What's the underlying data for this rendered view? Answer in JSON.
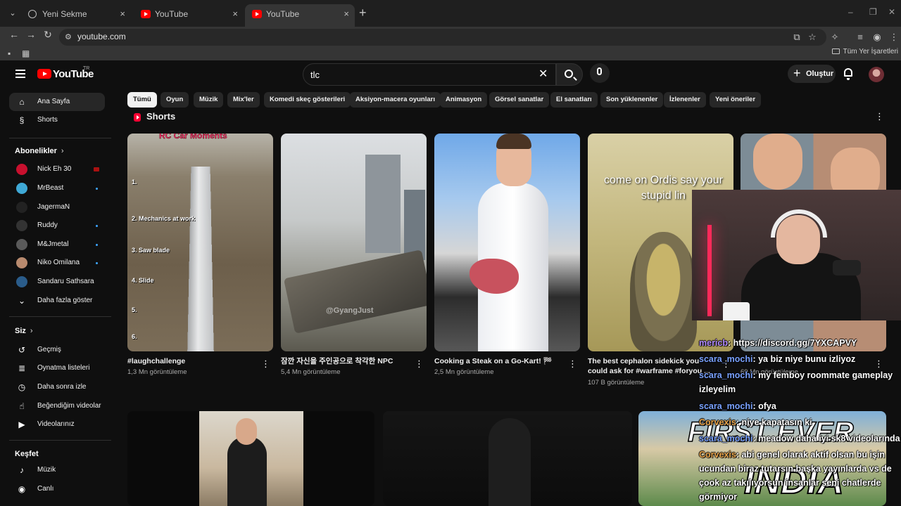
{
  "browser": {
    "tabs": [
      {
        "title": "Yeni Sekme",
        "favicon": "globe-icon"
      },
      {
        "title": "YouTube",
        "favicon": "youtube-icon"
      },
      {
        "title": "YouTube",
        "favicon": "youtube-icon"
      }
    ],
    "active_tab": 2,
    "url": "youtube.com",
    "bookmarks_label": "Tüm Yer İşaretleri"
  },
  "header": {
    "logo_text": "YouTube",
    "region": "TR",
    "search_value": "tlc",
    "create_label": "Oluştur"
  },
  "sidebar": {
    "main": [
      {
        "label": "Ana Sayfa",
        "icon": "home-icon",
        "active": true
      },
      {
        "label": "Shorts",
        "icon": "shorts-icon"
      }
    ],
    "subscriptions_title": "Abonelikler",
    "subscriptions": [
      {
        "label": "Nick Eh 30",
        "live": true,
        "color": "#c8102e"
      },
      {
        "label": "MrBeast",
        "dot": true,
        "color": "#3fa9d6"
      },
      {
        "label": "JagermaN",
        "dot": false,
        "color": "#222222"
      },
      {
        "label": "Ruddy",
        "dot": true,
        "color": "#333333"
      },
      {
        "label": "M&Jmetal",
        "dot": true,
        "color": "#5a5a5a"
      },
      {
        "label": "Niko Omilana",
        "dot": true,
        "color": "#b88a6e"
      },
      {
        "label": "Sandaru Sathsara",
        "dot": false,
        "color": "#2a5c8a"
      },
      {
        "label": "Daha fazla göster",
        "icon": "chevron-down-icon"
      }
    ],
    "you_title": "Siz",
    "you": [
      {
        "label": "Geçmiş",
        "icon": "history-icon"
      },
      {
        "label": "Oynatma listeleri",
        "icon": "playlist-icon"
      },
      {
        "label": "Daha sonra izle",
        "icon": "clock-icon"
      },
      {
        "label": "Beğendiğim videolar",
        "icon": "thumb-up-icon"
      },
      {
        "label": "Videolarınız",
        "icon": "video-icon"
      }
    ],
    "explore_title": "Keşfet",
    "explore": [
      {
        "label": "Müzik",
        "icon": "music-icon"
      },
      {
        "label": "Canlı",
        "icon": "live-icon"
      }
    ]
  },
  "chips": [
    "Tümü",
    "Oyun",
    "Müzik",
    "Mix'ler",
    "Komedi skeç gösterileri",
    "Aksiyon-macera oyunları",
    "Animasyon",
    "Görsel sanatlar",
    "El sanatları",
    "Son yüklenenler",
    "İzlenenler",
    "Yeni öneriler"
  ],
  "shorts": {
    "title": "Shorts",
    "items": [
      {
        "title": "#laughchallenge",
        "views": "1,3 Mn görüntüleme",
        "thumb_text": "RC Car Moments",
        "thumb_labels": [
          "1.",
          "2. Mechanics at work",
          "3. Saw blade",
          "4. Slide",
          "5.",
          "6."
        ]
      },
      {
        "title": "잠깐 자신을 주인공으로 착각한 NPC",
        "views": "5,4 Mn görüntüleme",
        "thumb_text": "@GyangJust"
      },
      {
        "title": "Cooking a Steak on a Go-Kart! 🏁",
        "views": "2,5 Mn görüntüleme"
      },
      {
        "title": "The best cephalon sidekick you could ask for #warframe #foryou ...",
        "views": "107 B görüntüleme",
        "thumb_text": "come on Ordis say your stupid lin"
      },
      {
        "title": "...",
        "views": "69 Mn görüntüleme"
      }
    ]
  },
  "chat": [
    {
      "user": "mericb",
      "text": ": https://discord.gg/7YXCAPVY",
      "color": "purple"
    },
    {
      "user": "scara_mochi",
      "text": ": ya biz niye bunu izliyoz"
    },
    {
      "user": "scara_mochi",
      "text": ": my femboy roommate gameplay izleyelim"
    },
    {
      "user": "scara_mochi",
      "text": ": ofya"
    },
    {
      "user": "Corvexis",
      "text": ": niye kapatasın ki",
      "color": "orange"
    },
    {
      "user": "scara_mochi",
      "text": ": meadow daha iyi sk8 videolarında"
    },
    {
      "user": "Corvexis",
      "text": ": abi genel olarak aktif olsan bu işin ucundan biraz tutarsın başka yayınlarda vs de çook az takılıyorsun insanlar seni chatlerde görmiyor",
      "color": "orange"
    }
  ],
  "videos": [
    {
      "thumb_text": ""
    },
    {
      "thumb_text": ""
    },
    {
      "thumb_text": "FIRST EVER",
      "thumb_text2": "INDIA"
    }
  ]
}
